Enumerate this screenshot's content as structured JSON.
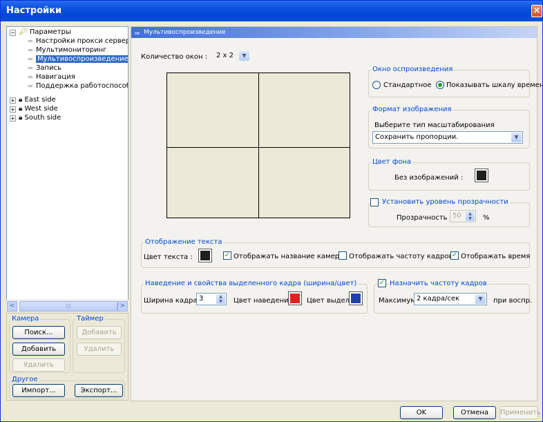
{
  "window": {
    "title": "Настройки",
    "close": "×"
  },
  "tree": {
    "root": "Параметры",
    "children": [
      "Настройки прокси сервер",
      "Мультимониторинг",
      "Мультивоспроизведение",
      "Запись",
      "Навигация",
      "Поддержка работоспособ"
    ],
    "sites": [
      "East side",
      "West side",
      "South side"
    ],
    "expand": "−",
    "collapse": "+"
  },
  "scroll": {
    "left": "<",
    "right": ">",
    "grip": "|||"
  },
  "left_panel": {
    "camera_title": "Камера",
    "timer_title": "Таймер",
    "search": "Поиск...",
    "add": "Добавить",
    "remove": "Удалить",
    "timer_add": "Добавить",
    "timer_remove": "Удалить",
    "other_title": "Другое",
    "import": "Импорт...",
    "export": "Экспорт..."
  },
  "main": {
    "header": "Мультивоспроизведение",
    "windows_label": "Количество окон :",
    "windows_value": "2 x 2",
    "playback_group": "Окно оспроизведения",
    "radio_standard": "Стандартное",
    "radio_timeline": "Показывать шкалу времен",
    "format_group": "Формат изображения",
    "scale_label": "Выберите тип масштабирования",
    "scale_value": "Сохранить пропорции.",
    "bg_group": "Цвет фона",
    "no_image": "Без изображений :",
    "transparency_check": "Установить уровень прозрачности",
    "transparency_label": "Прозрачность :",
    "transparency_value": "50",
    "percent": "%",
    "text_group": "Отображение текста",
    "text_color": "Цвет текста :",
    "show_camera": "Отображать название камеры",
    "show_fps": "Отображать частоту кадров",
    "show_time": "Отображать время",
    "hover_group": "Наведение и свойства выделенного кадра (ширина/цвет)",
    "frame_width": "Ширина кадра :",
    "frame_width_value": "3",
    "hover_color": "Цвет наведения",
    "select_color": "Цвет выдел.",
    "fps_group": "Назначить частоту кадров",
    "max_label": "Максимум",
    "max_value": "2 кадра/сек",
    "on_play": "при воспр."
  },
  "footer": {
    "ok": "OK",
    "cancel": "Отмена",
    "apply": "Применить"
  },
  "colors": {
    "bg": "#202020",
    "text": "#202020",
    "hover": "#e62020",
    "select": "#2040a8"
  }
}
